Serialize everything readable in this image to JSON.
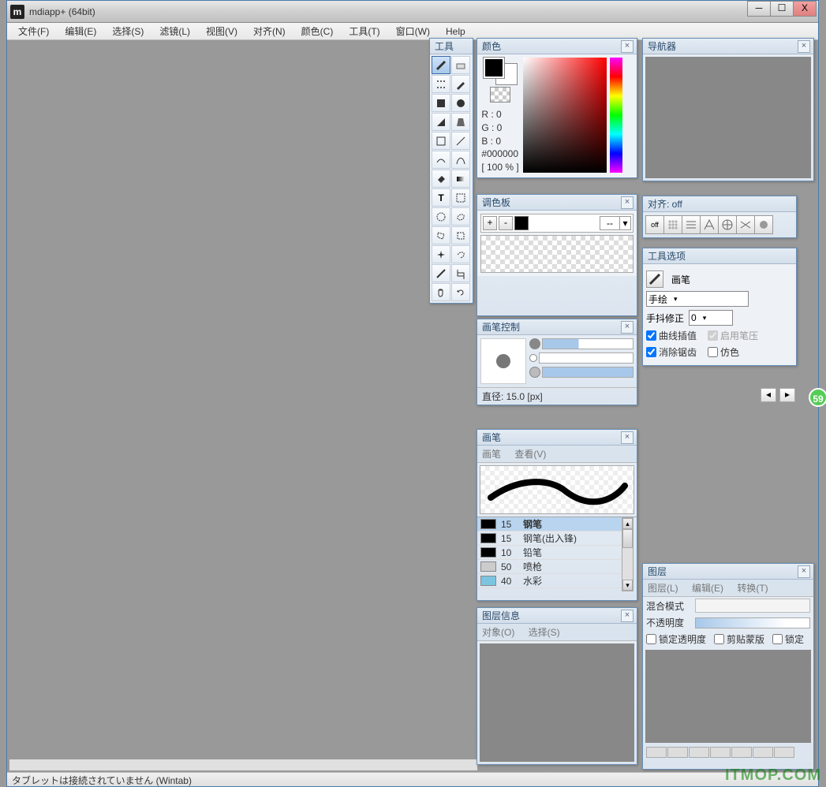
{
  "title": "mdiapp+ (64bit)",
  "win_controls": {
    "min": "─",
    "max": "☐",
    "close": "X"
  },
  "menus": [
    "文件(F)",
    "编辑(E)",
    "选择(S)",
    "滤镜(L)",
    "视图(V)",
    "对齐(N)",
    "颜色(C)",
    "工具(T)",
    "窗口(W)",
    "Help"
  ],
  "status": "タブレットは接続されていません (Wintab)",
  "tools_panel": {
    "title": "工具"
  },
  "color_panel": {
    "title": "颜色",
    "r": "R : 0",
    "g": "G : 0",
    "b": "B : 0",
    "hex": "#000000",
    "opacity": "[ 100 % ]"
  },
  "nav_panel": {
    "title": "导航器"
  },
  "palette_panel": {
    "title": "调色板",
    "add": "+",
    "del": "-",
    "dd": "--"
  },
  "align_panel": {
    "title": "对齐: off",
    "first": "off"
  },
  "topts_panel": {
    "title": "工具选项",
    "tool": "画笔",
    "mode": "手绘",
    "stab_label": "手抖修正",
    "stab_val": "0",
    "curve": "曲线插值",
    "pressure": "启用笔压",
    "aa": "消除锯齿",
    "dither": "仿色"
  },
  "brushctl_panel": {
    "title": "画笔控制",
    "diameter": "直径: 15.0 [px]"
  },
  "brush_panel": {
    "title": "画笔",
    "sub": [
      "画笔",
      "查看(V)"
    ],
    "items": [
      {
        "size": "15",
        "name": "钢笔",
        "fill": "#000",
        "sel": true
      },
      {
        "size": "15",
        "name": "钢笔(出入锋)",
        "fill": "#000"
      },
      {
        "size": "10",
        "name": "铅笔",
        "fill": "#000"
      },
      {
        "size": "50",
        "name": "喷枪",
        "fill": "#ccc"
      },
      {
        "size": "40",
        "name": "水彩",
        "fill": "#7bc5e0"
      }
    ]
  },
  "linfo_panel": {
    "title": "图层信息",
    "sub": [
      "对象(O)",
      "选择(S)"
    ]
  },
  "layers_panel": {
    "title": "图层",
    "sub": [
      "图层(L)",
      "编辑(E)",
      "转换(T)"
    ],
    "blend_label": "混合模式",
    "opacity_label": "不透明度",
    "lock_opacity": "锁定透明度",
    "clip": "剪贴蒙版",
    "lock": "锁定"
  },
  "watermark": "ITMOP.COM",
  "badge": "59"
}
